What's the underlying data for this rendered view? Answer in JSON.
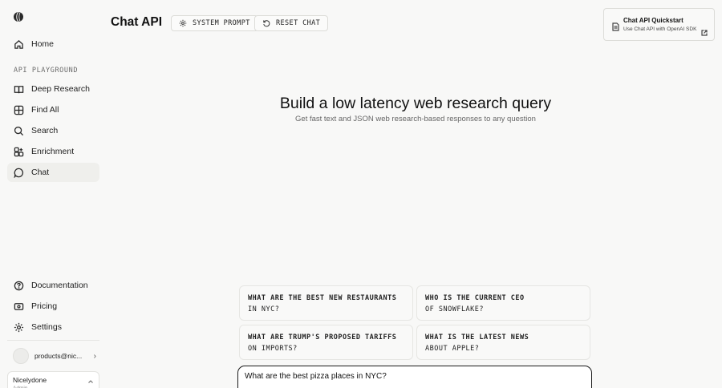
{
  "sidebar": {
    "logo_icon": "sphere-logo-icon",
    "top_item": {
      "label": "Home",
      "icon": "home-icon"
    },
    "section_label": "API PLAYGROUND",
    "items": [
      {
        "label": "Deep Research",
        "icon": "book-open-icon"
      },
      {
        "label": "Find All",
        "icon": "table-grid-icon"
      },
      {
        "label": "Search",
        "icon": "search-icon"
      },
      {
        "label": "Enrichment",
        "icon": "enrichment-icon"
      },
      {
        "label": "Chat",
        "icon": "chat-bubble-icon",
        "active": true
      }
    ],
    "bottom_items": [
      {
        "label": "Documentation",
        "icon": "help-circle-icon"
      },
      {
        "label": "Pricing",
        "icon": "credit-card-icon"
      },
      {
        "label": "Settings",
        "icon": "gear-icon"
      }
    ],
    "user": {
      "email": "products@nic...",
      "chevron": "›"
    },
    "org": {
      "name": "Nicelydone",
      "role": "Admin"
    }
  },
  "header": {
    "title": "Chat API",
    "buttons": [
      {
        "label": "SYSTEM PROMPT",
        "icon": "gear-icon"
      },
      {
        "label": "RESET CHAT",
        "icon": "reset-icon"
      }
    ]
  },
  "quickstart": {
    "title": "Chat API Quickstart",
    "subtitle": "Use Chat API with OpenAI SDK"
  },
  "hero": {
    "title": "Build a low latency web research query",
    "subtitle": "Get fast text and JSON web research-based responses to any question"
  },
  "suggestions": [
    {
      "line1": "WHAT ARE THE BEST NEW RESTAURANTS",
      "line2": "IN NYC?"
    },
    {
      "line1": "WHO IS THE CURRENT CEO",
      "line2": "OF SNOWFLAKE?"
    },
    {
      "line1": "WHAT ARE TRUMP'S PROPOSED TARIFFS",
      "line2": "ON IMPORTS?"
    },
    {
      "line1": "WHAT IS THE LATEST NEWS",
      "line2": "ABOUT APPLE?"
    }
  ],
  "chat_input": {
    "value": "What are the best pizza places in NYC?"
  },
  "colors": {
    "background": "#f8f8f7",
    "active_nav": "#efefec",
    "text": "#1f1f1f",
    "border": "#dcdcd8"
  }
}
